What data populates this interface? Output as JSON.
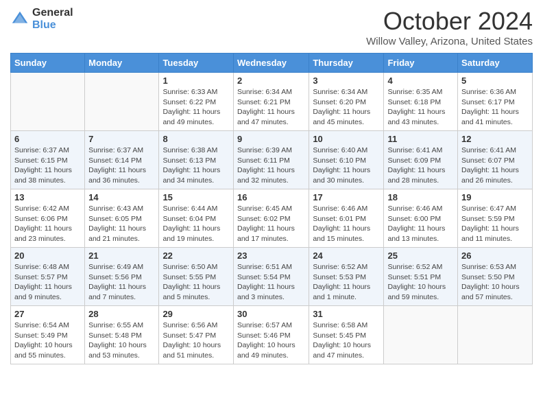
{
  "header": {
    "logo_general": "General",
    "logo_blue": "Blue",
    "month_title": "October 2024",
    "location": "Willow Valley, Arizona, United States"
  },
  "weekdays": [
    "Sunday",
    "Monday",
    "Tuesday",
    "Wednesday",
    "Thursday",
    "Friday",
    "Saturday"
  ],
  "weeks": [
    [
      {
        "day": "",
        "info": ""
      },
      {
        "day": "",
        "info": ""
      },
      {
        "day": "1",
        "info": "Sunrise: 6:33 AM\nSunset: 6:22 PM\nDaylight: 11 hours and 49 minutes."
      },
      {
        "day": "2",
        "info": "Sunrise: 6:34 AM\nSunset: 6:21 PM\nDaylight: 11 hours and 47 minutes."
      },
      {
        "day": "3",
        "info": "Sunrise: 6:34 AM\nSunset: 6:20 PM\nDaylight: 11 hours and 45 minutes."
      },
      {
        "day": "4",
        "info": "Sunrise: 6:35 AM\nSunset: 6:18 PM\nDaylight: 11 hours and 43 minutes."
      },
      {
        "day": "5",
        "info": "Sunrise: 6:36 AM\nSunset: 6:17 PM\nDaylight: 11 hours and 41 minutes."
      }
    ],
    [
      {
        "day": "6",
        "info": "Sunrise: 6:37 AM\nSunset: 6:15 PM\nDaylight: 11 hours and 38 minutes."
      },
      {
        "day": "7",
        "info": "Sunrise: 6:37 AM\nSunset: 6:14 PM\nDaylight: 11 hours and 36 minutes."
      },
      {
        "day": "8",
        "info": "Sunrise: 6:38 AM\nSunset: 6:13 PM\nDaylight: 11 hours and 34 minutes."
      },
      {
        "day": "9",
        "info": "Sunrise: 6:39 AM\nSunset: 6:11 PM\nDaylight: 11 hours and 32 minutes."
      },
      {
        "day": "10",
        "info": "Sunrise: 6:40 AM\nSunset: 6:10 PM\nDaylight: 11 hours and 30 minutes."
      },
      {
        "day": "11",
        "info": "Sunrise: 6:41 AM\nSunset: 6:09 PM\nDaylight: 11 hours and 28 minutes."
      },
      {
        "day": "12",
        "info": "Sunrise: 6:41 AM\nSunset: 6:07 PM\nDaylight: 11 hours and 26 minutes."
      }
    ],
    [
      {
        "day": "13",
        "info": "Sunrise: 6:42 AM\nSunset: 6:06 PM\nDaylight: 11 hours and 23 minutes."
      },
      {
        "day": "14",
        "info": "Sunrise: 6:43 AM\nSunset: 6:05 PM\nDaylight: 11 hours and 21 minutes."
      },
      {
        "day": "15",
        "info": "Sunrise: 6:44 AM\nSunset: 6:04 PM\nDaylight: 11 hours and 19 minutes."
      },
      {
        "day": "16",
        "info": "Sunrise: 6:45 AM\nSunset: 6:02 PM\nDaylight: 11 hours and 17 minutes."
      },
      {
        "day": "17",
        "info": "Sunrise: 6:46 AM\nSunset: 6:01 PM\nDaylight: 11 hours and 15 minutes."
      },
      {
        "day": "18",
        "info": "Sunrise: 6:46 AM\nSunset: 6:00 PM\nDaylight: 11 hours and 13 minutes."
      },
      {
        "day": "19",
        "info": "Sunrise: 6:47 AM\nSunset: 5:59 PM\nDaylight: 11 hours and 11 minutes."
      }
    ],
    [
      {
        "day": "20",
        "info": "Sunrise: 6:48 AM\nSunset: 5:57 PM\nDaylight: 11 hours and 9 minutes."
      },
      {
        "day": "21",
        "info": "Sunrise: 6:49 AM\nSunset: 5:56 PM\nDaylight: 11 hours and 7 minutes."
      },
      {
        "day": "22",
        "info": "Sunrise: 6:50 AM\nSunset: 5:55 PM\nDaylight: 11 hours and 5 minutes."
      },
      {
        "day": "23",
        "info": "Sunrise: 6:51 AM\nSunset: 5:54 PM\nDaylight: 11 hours and 3 minutes."
      },
      {
        "day": "24",
        "info": "Sunrise: 6:52 AM\nSunset: 5:53 PM\nDaylight: 11 hours and 1 minute."
      },
      {
        "day": "25",
        "info": "Sunrise: 6:52 AM\nSunset: 5:51 PM\nDaylight: 10 hours and 59 minutes."
      },
      {
        "day": "26",
        "info": "Sunrise: 6:53 AM\nSunset: 5:50 PM\nDaylight: 10 hours and 57 minutes."
      }
    ],
    [
      {
        "day": "27",
        "info": "Sunrise: 6:54 AM\nSunset: 5:49 PM\nDaylight: 10 hours and 55 minutes."
      },
      {
        "day": "28",
        "info": "Sunrise: 6:55 AM\nSunset: 5:48 PM\nDaylight: 10 hours and 53 minutes."
      },
      {
        "day": "29",
        "info": "Sunrise: 6:56 AM\nSunset: 5:47 PM\nDaylight: 10 hours and 51 minutes."
      },
      {
        "day": "30",
        "info": "Sunrise: 6:57 AM\nSunset: 5:46 PM\nDaylight: 10 hours and 49 minutes."
      },
      {
        "day": "31",
        "info": "Sunrise: 6:58 AM\nSunset: 5:45 PM\nDaylight: 10 hours and 47 minutes."
      },
      {
        "day": "",
        "info": ""
      },
      {
        "day": "",
        "info": ""
      }
    ]
  ]
}
